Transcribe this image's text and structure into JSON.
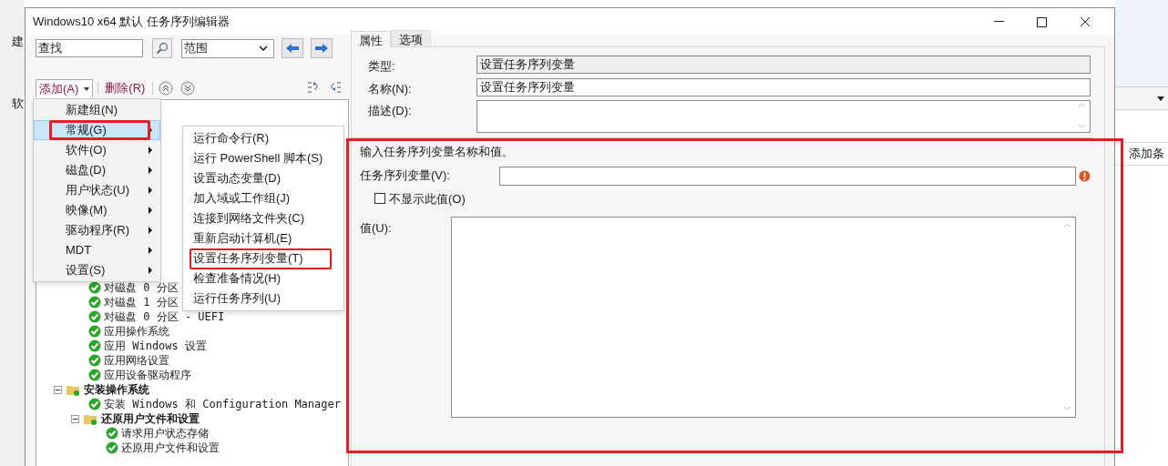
{
  "window": {
    "title": "Windows10 x64 默认 任务序列编辑器"
  },
  "search": {
    "value": "查找"
  },
  "scope": {
    "value": "范围"
  },
  "toolbar": {
    "add": "添加(A)",
    "delete": "删除(R)"
  },
  "add_menu": [
    {
      "label": "新建组(N)",
      "submenu": false,
      "selected": false,
      "annotated": false
    },
    {
      "label": "常规(G)",
      "submenu": true,
      "selected": true,
      "annotated": true
    },
    {
      "label": "软件(O)",
      "submenu": true,
      "selected": false,
      "annotated": false
    },
    {
      "label": "磁盘(D)",
      "submenu": true,
      "selected": false,
      "annotated": false
    },
    {
      "label": "用户状态(U)",
      "submenu": true,
      "selected": false,
      "annotated": false
    },
    {
      "label": "映像(M)",
      "submenu": true,
      "selected": false,
      "annotated": false
    },
    {
      "label": "驱动程序(R)",
      "submenu": true,
      "selected": false,
      "annotated": false
    },
    {
      "label": "MDT",
      "submenu": true,
      "selected": false,
      "annotated": false
    },
    {
      "label": "设置(S)",
      "submenu": true,
      "selected": false,
      "annotated": false
    }
  ],
  "submenu": [
    {
      "label": "运行命令行(R)",
      "annotated": false
    },
    {
      "label": "运行 PowerShell 脚本(S)",
      "annotated": false
    },
    {
      "label": "设置动态变量(D)",
      "annotated": false
    },
    {
      "label": "加入域或工作组(J)",
      "annotated": false
    },
    {
      "label": "连接到网络文件夹(C)",
      "annotated": false
    },
    {
      "label": "重新启动计算机(E)",
      "annotated": false
    },
    {
      "label": "设置任务序列变量(T)",
      "annotated": true
    },
    {
      "label": "检查准备情况(H)",
      "annotated": false
    },
    {
      "label": "运行任务序列(U)",
      "annotated": false
    }
  ],
  "tree": [
    {
      "kind": "continued",
      "children": [
        {
          "kind": "step",
          "label": "对磁盘 0 分区"
        },
        {
          "kind": "step",
          "label": "对磁盘 1 分区"
        },
        {
          "kind": "step",
          "label": "对磁盘 0 分区 - UEFI"
        },
        {
          "kind": "step",
          "label": "应用操作系统"
        },
        {
          "kind": "step",
          "label": "应用 Windows 设置"
        },
        {
          "kind": "step",
          "label": "应用网络设置"
        },
        {
          "kind": "step",
          "label": "应用设备驱动程序"
        }
      ]
    },
    {
      "kind": "group",
      "label": "安装操作系统",
      "expanded": true,
      "children": [
        {
          "kind": "step",
          "label": "安装 Windows 和 Configuration Manager"
        },
        {
          "kind": "group",
          "label": "还原用户文件和设置",
          "expanded": true,
          "children": [
            {
              "kind": "step",
              "label": "请求用户状态存储"
            },
            {
              "kind": "step",
              "label": "还原用户文件和设置"
            }
          ]
        }
      ]
    }
  ],
  "tabs": [
    {
      "label": "属性",
      "selected": true
    },
    {
      "label": "选项",
      "selected": false
    }
  ],
  "properties": {
    "type_label": "类型:",
    "type_value": "设置任务序列变量",
    "name_label": "名称(N):",
    "name_value": "设置任务序列变量",
    "description_label": "描述(D):"
  },
  "variable_section": {
    "annotated": true,
    "instruction": "输入任务序列变量名称和值。",
    "variable_label": "任务序列变量(V):",
    "variable_error": true,
    "hide_value": {
      "label": "不显示此值(O)",
      "checked": false
    },
    "value_label": "值(U):"
  },
  "background": {
    "left_texts": [
      "建",
      "软"
    ],
    "right_text": "添加条"
  }
}
